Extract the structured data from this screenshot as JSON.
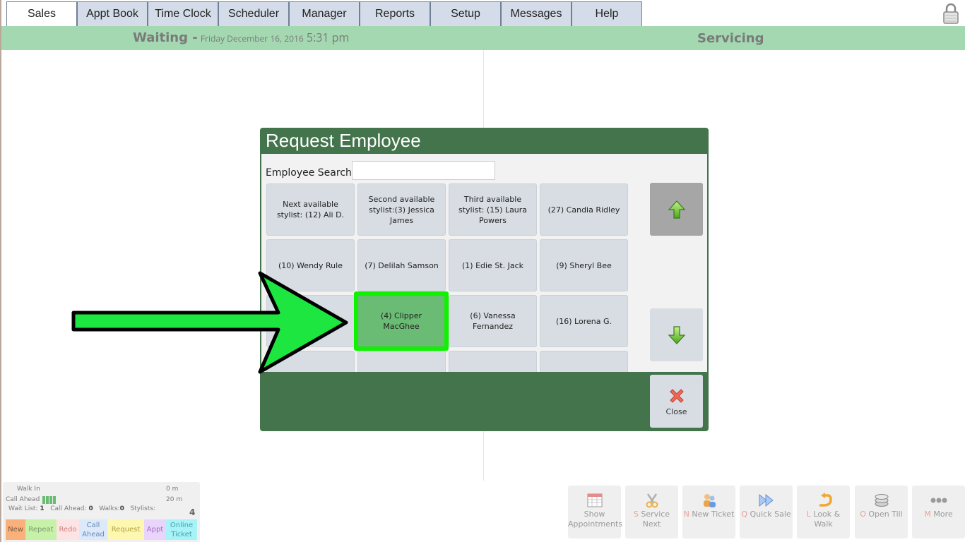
{
  "tabs": [
    {
      "label": "Sales",
      "active": true
    },
    {
      "label": "Appt Book",
      "active": false
    },
    {
      "label": "Time Clock",
      "active": false
    },
    {
      "label": "Scheduler",
      "active": false
    },
    {
      "label": "Manager",
      "active": false
    },
    {
      "label": "Reports",
      "active": false
    },
    {
      "label": "Setup",
      "active": false
    },
    {
      "label": "Messages",
      "active": false
    },
    {
      "label": "Help",
      "active": false
    }
  ],
  "header": {
    "waiting_title": "Waiting -",
    "date": "Friday December 16, 2016",
    "time": "5:31 pm",
    "servicing_title": "Servicing"
  },
  "dialog": {
    "title": "Request Employee",
    "search_label": "Employee Search:",
    "search_value": "",
    "employees": [
      "Next available stylist: (12) Ali D.",
      "Second available stylist:(3) Jessica James",
      "Third available stylist: (15) Laura Powers",
      "(27) Candia Ridley",
      "(10) Wendy Rule",
      "(7) Delilah Samson",
      "(1) Edie St. Jack",
      "(9) Sheryl Bee",
      "",
      "(4) Clipper MacGhee",
      "(6) Vanessa Fernandez",
      "(16) Lorena G.",
      "",
      "",
      "",
      ""
    ],
    "selected_employee": "(4) Clipper MacGhee",
    "close_label": "Close",
    "up_icon": "green-up-arrow-icon",
    "down_icon": "green-down-arrow-icon"
  },
  "stats": {
    "walk_in_label": "Walk In",
    "walk_in_time": "0 m",
    "call_ahead_label": "Call Ahead",
    "call_ahead_time": "20 m",
    "wait_list_label": "Wait List:",
    "wait_list_value": "1",
    "call_ahead_count_label": "Call Ahead:",
    "call_ahead_count_value": "0",
    "walks_label": "Walks:",
    "walks_value": "0",
    "stylists_label": "Stylists:",
    "stylists_value": "4",
    "categories": [
      {
        "label": "New",
        "color": "#f9b07a",
        "text": "#7a5a3a"
      },
      {
        "label": "Repeat",
        "color": "#c7f0a8",
        "text": "#7a9a6a"
      },
      {
        "label": "Redo",
        "color": "#fde3e3",
        "text": "#d08080"
      },
      {
        "label": "Call Ahead",
        "color": "#dbe9fb",
        "text": "#6a8ab0"
      },
      {
        "label": "Request",
        "color": "#fdf7b0",
        "text": "#b0a040"
      },
      {
        "label": "Appt",
        "color": "#e9d4fb",
        "text": "#a070c0"
      },
      {
        "label": "Online Ticket",
        "color": "#a8f3f7",
        "text": "#40a0b0"
      }
    ]
  },
  "actions": [
    {
      "key": "",
      "label": "Show Appointments",
      "icon": "calendar-icon"
    },
    {
      "key": "S",
      "label": "Service Next",
      "icon": "scissors-icon"
    },
    {
      "key": "N",
      "label": "New Ticket",
      "icon": "people-icon"
    },
    {
      "key": "Q",
      "label": "Quick Sale",
      "icon": "fast-forward-icon"
    },
    {
      "key": "L",
      "label": "Look & Walk",
      "icon": "u-turn-arrow-icon"
    },
    {
      "key": "O",
      "label": "Open Till",
      "icon": "coins-icon"
    },
    {
      "key": "M",
      "label": "More",
      "icon": "more-dots-icon"
    }
  ]
}
